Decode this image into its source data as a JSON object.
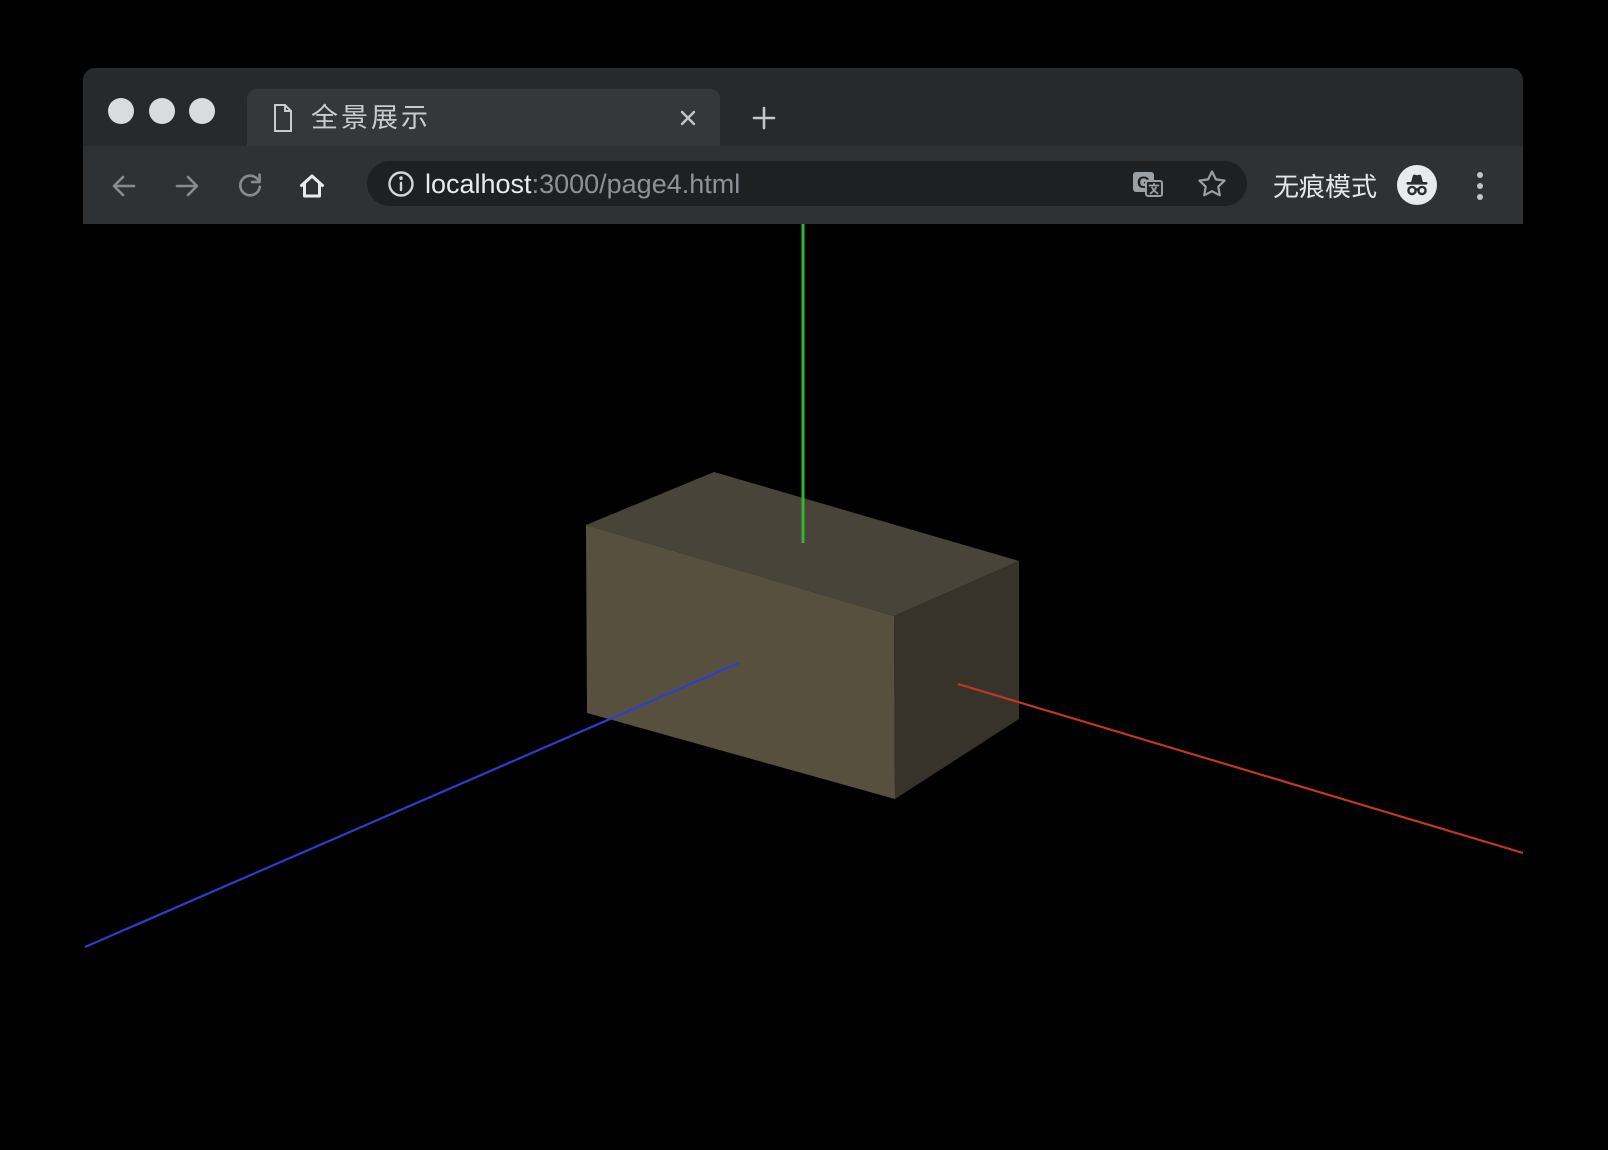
{
  "window": {
    "controls": {
      "color": "#d9dbdc",
      "names": [
        "close",
        "minimize",
        "zoom"
      ]
    },
    "surfaces": {
      "tabbar": "#27292b",
      "tab": "#35383b",
      "navbar": "#2f3235",
      "omnibox": "#1e2022",
      "content": "#000000"
    }
  },
  "tabbar": {
    "tab_title": "全景展示"
  },
  "navbar": {
    "url_host": "localhost",
    "url_rest": ":3000/page4.html",
    "incognito_label": "无痕模式"
  },
  "icons": {
    "favicon": "document-outline",
    "tab_close": "x",
    "new_tab": "plus",
    "back": "arrow-left",
    "forward": "arrow-right",
    "reload": "refresh-arc",
    "home": "house",
    "page_info": "info-circle",
    "translate": "google-translate",
    "translate_glyph": "G",
    "bookmark": "star-outline",
    "incognito": "hat-and-glasses",
    "menu": "three-dots-vertical"
  },
  "icon_colors": {
    "dim": "#888c90",
    "bright": "#e9ebed",
    "mid": "#9ba0a4",
    "light": "#c3c6c9",
    "favicon": "#c9ccce",
    "info": "#d2d5d8",
    "badge_bg": "#e8eaed",
    "badge_glyph": "#2b2d30"
  },
  "scene": {
    "description": "3D box with axes helper on black background",
    "box": {
      "top_face_color": "#49443a",
      "front_face_color": "#57503f",
      "right_face_color": "#37332b"
    },
    "axes": {
      "x_axis_color": "#c23720",
      "y_axis_color": "#35b435",
      "z_axis_color": "#2c3ed0"
    }
  }
}
